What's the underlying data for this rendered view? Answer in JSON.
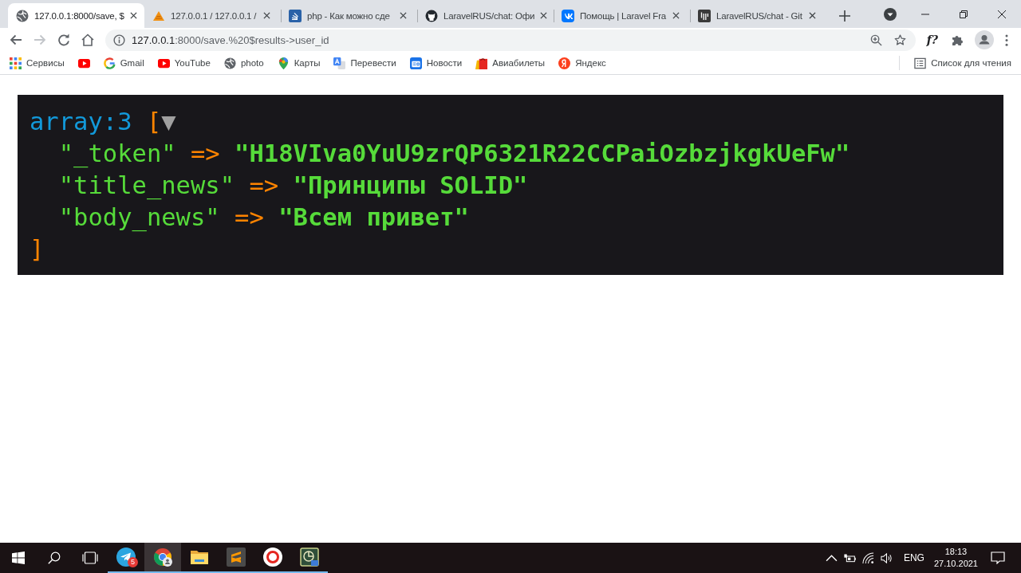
{
  "tabs": [
    {
      "title": "127.0.0.1:8000/save, $",
      "selected": true
    },
    {
      "title": "127.0.0.1 / 127.0.0.1 /",
      "selected": false
    },
    {
      "title": "php - Как можно сде",
      "selected": false
    },
    {
      "title": "LaravelRUS/chat: Офи",
      "selected": false
    },
    {
      "title": "Помощь | Laravel Fra",
      "selected": false
    },
    {
      "title": "LaravelRUS/chat - Git",
      "selected": false
    }
  ],
  "toolbar": {
    "forward_disabled": true,
    "url_host": "127.0.0.1",
    "url_path": ":8000/save.%20$results->user_id",
    "extension_label": "f?"
  },
  "bookmarks": [
    {
      "kind": "link",
      "label": "Сервисы"
    },
    {
      "kind": "icon"
    },
    {
      "kind": "link",
      "label": "Gmail"
    },
    {
      "kind": "link",
      "label": "YouTube"
    },
    {
      "kind": "link",
      "label": "photo"
    },
    {
      "kind": "link",
      "label": "Карты"
    },
    {
      "kind": "link",
      "label": "Перевести"
    },
    {
      "kind": "link",
      "label": "Новости"
    },
    {
      "kind": "link",
      "label": "Авиабилеты"
    },
    {
      "kind": "link",
      "label": "Яндекс"
    }
  ],
  "reading_list": "Список для чтения",
  "dump": {
    "type_label": "array:3",
    "open_bracket": "[",
    "toggle": "▼",
    "entries": [
      {
        "key": "\"_token\"",
        "arrow": "=>",
        "value": "\"H18VIva0YuU9zrQP6321R22CCPaiOzbzjkgkUeFw\""
      },
      {
        "key": "\"title_news\"",
        "arrow": "=>",
        "value": "\"Принципы SOLID\""
      },
      {
        "key": "\"body_news\"",
        "arrow": "=>",
        "value": "\"Всем привет\""
      }
    ],
    "close_bracket": "]"
  },
  "taskbar": {
    "apps": [
      {
        "selected": false,
        "badge": "5"
      },
      {
        "selected": true
      },
      {
        "selected": false
      },
      {
        "selected": false
      },
      {
        "selected": false
      },
      {
        "selected": false
      }
    ],
    "language": "ENG",
    "time": "18:13",
    "date": "27.10.2021"
  }
}
